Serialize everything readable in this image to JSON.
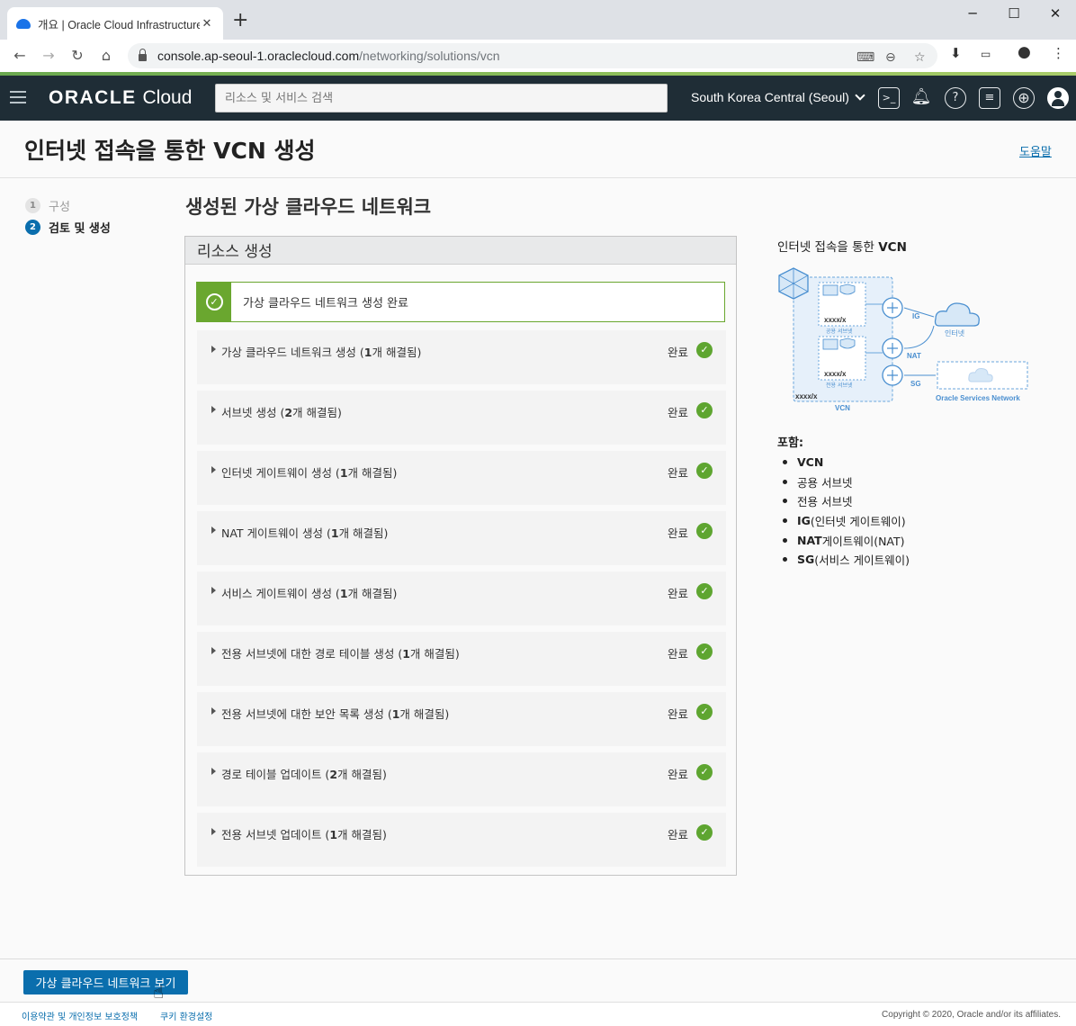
{
  "browser": {
    "tab_title": "개요 | Oracle Cloud Infrastructure",
    "url_host": "console.ap-seoul-1.oraclecloud.com",
    "url_path": "/networking/solutions/vcn",
    "new_tab": "+",
    "close_tab": "✕"
  },
  "topnav": {
    "brand_bold": "ORACLE",
    "brand_light": "Cloud",
    "search_placeholder": "리소스 및 서비스 검색",
    "region": "South Korea Central (Seoul)",
    "icons": [
      "cloud-shell-icon",
      "bell-icon",
      "help-icon",
      "chat-icon",
      "globe-icon",
      "profile-icon"
    ]
  },
  "page": {
    "title_prefix": "인터넷 접속을 통한 ",
    "title_bold": "VCN",
    "title_suffix": " 생성",
    "help": "도움말"
  },
  "steps": [
    {
      "num": "1",
      "label": "구성",
      "state": "done"
    },
    {
      "num": "2",
      "label": "검토 및 생성",
      "state": "current"
    }
  ],
  "main": {
    "title": "생성된 가상 클라우드 네트워크",
    "panel_title": "리소스 생성",
    "banner": "가상 클라우드 네트워크 생성 완료",
    "status_label": "완료",
    "rows": [
      {
        "pre": "가상 클라우드 네트워크 생성 (",
        "bold": "1",
        "post": "개 해결됨)"
      },
      {
        "pre": "서브넷 생성 (",
        "bold": "2",
        "post": "개 해결됨)"
      },
      {
        "pre": "인터넷 게이트웨이 생성 (",
        "bold": "1",
        "post": "개 해결됨)"
      },
      {
        "pre": "NAT 게이트웨이 생성 (",
        "bold": "1",
        "post": "개 해결됨)"
      },
      {
        "pre": "서비스 게이트웨이 생성 (",
        "bold": "1",
        "post": "개 해결됨)"
      },
      {
        "pre": "전용 서브넷에 대한 경로 테이블 생성 (",
        "bold": "1",
        "post": "개 해결됨)"
      },
      {
        "pre": "전용 서브넷에 대한 보안 목록 생성 (",
        "bold": "1",
        "post": "개 해결됨)"
      },
      {
        "pre": "경로 테이블 업데이트 (",
        "bold": "2",
        "post": "개 해결됨)"
      },
      {
        "pre": "전용 서브넷 업데이트 (",
        "bold": "1",
        "post": "개 해결됨)"
      }
    ]
  },
  "sidebar": {
    "title_prefix": "인터넷 접속을 통한 ",
    "title_bold": "VCN",
    "diagram": {
      "cidr_vcn": "xxxx/x",
      "cidr_subnet": "xxxx/x",
      "public_subnet": "공용 서브넷",
      "private_subnet": "전용 서브넷",
      "vcn": "VCN",
      "ig": "IG",
      "nat": "NAT",
      "sg": "SG",
      "internet": "인터넷",
      "osn": "Oracle Services Network"
    },
    "includes_title": "포함:",
    "includes": [
      {
        "bold": "VCN",
        "text": ""
      },
      {
        "bold": "",
        "text": "공용 서브넷"
      },
      {
        "bold": "",
        "text": "전용 서브넷"
      },
      {
        "bold": "IG",
        "text": "(인터넷 게이트웨이)"
      },
      {
        "bold": "NAT",
        "text": " 게이트웨이(NAT)"
      },
      {
        "bold": "SG",
        "text": "(서비스 게이트웨이)"
      }
    ]
  },
  "bottom": {
    "view_button": "가상 클라우드 네트워크 보기"
  },
  "footer": {
    "terms": "이용약관 및 개인정보 보호정책",
    "cookies": "쿠키 환경설정",
    "copyright": "Copyright © 2020, Oracle and/or its affiliates."
  },
  "colors": {
    "nav_bg": "#1f2d36",
    "accent": "#0a6ead",
    "success": "#6aa72f"
  }
}
